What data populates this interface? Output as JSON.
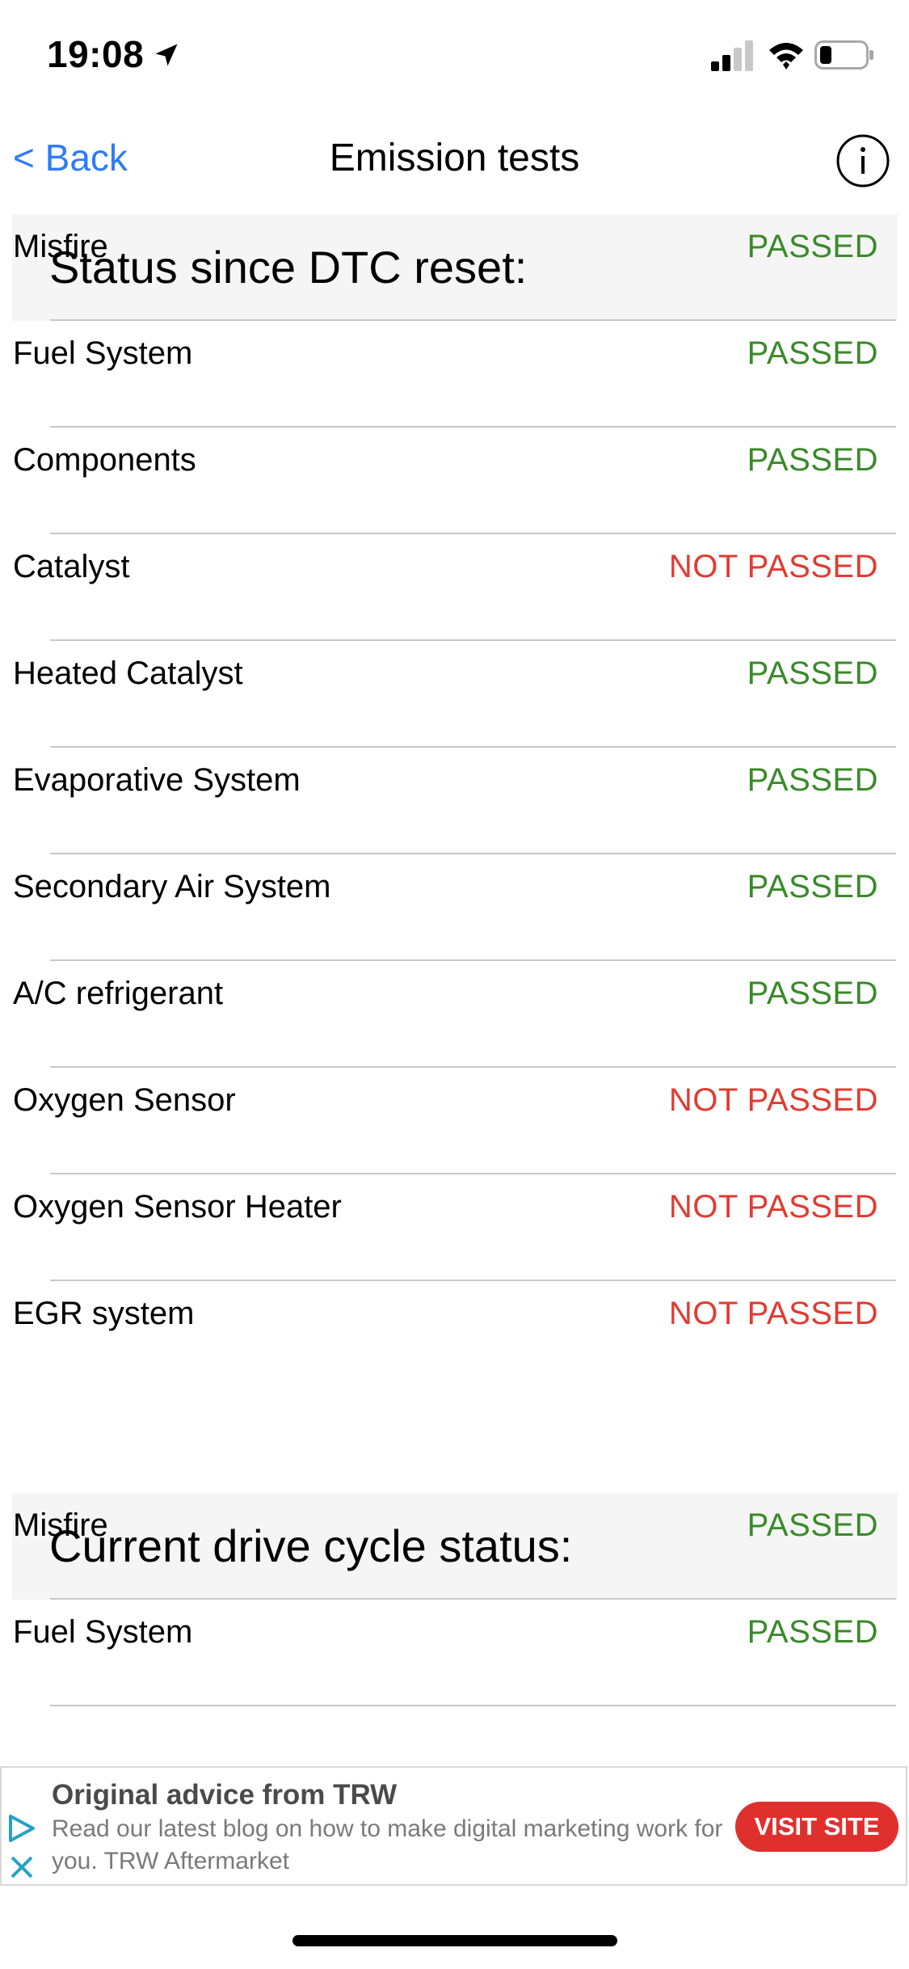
{
  "status_bar": {
    "time": "19:08"
  },
  "nav": {
    "back_label": "< Back",
    "title": "Emission tests"
  },
  "sections": [
    {
      "title": "Status since DTC reset:",
      "rows": [
        {
          "label": "Misfire",
          "status": "PASSED",
          "passed": true
        },
        {
          "label": "Fuel System",
          "status": "PASSED",
          "passed": true
        },
        {
          "label": "Components",
          "status": "PASSED",
          "passed": true
        },
        {
          "label": "Catalyst",
          "status": "NOT PASSED",
          "passed": false
        },
        {
          "label": "Heated Catalyst",
          "status": "PASSED",
          "passed": true
        },
        {
          "label": "Evaporative System",
          "status": "PASSED",
          "passed": true
        },
        {
          "label": "Secondary Air System",
          "status": "PASSED",
          "passed": true
        },
        {
          "label": "A/C refrigerant",
          "status": "PASSED",
          "passed": true
        },
        {
          "label": "Oxygen Sensor",
          "status": "NOT PASSED",
          "passed": false
        },
        {
          "label": "Oxygen Sensor Heater",
          "status": "NOT PASSED",
          "passed": false
        },
        {
          "label": "EGR system",
          "status": "NOT PASSED",
          "passed": false
        }
      ]
    },
    {
      "title": "Current drive cycle status:",
      "rows": [
        {
          "label": "Misfire",
          "status": "PASSED",
          "passed": true
        },
        {
          "label": "Fuel System",
          "status": "PASSED",
          "passed": true
        }
      ]
    }
  ],
  "ad": {
    "title": "Original advice from TRW",
    "body": "Read our latest blog on how to make digital marketing work for you. TRW Aftermarket",
    "button_label": "VISIT SITE"
  },
  "colors": {
    "passed": "#3a8a2a",
    "not_passed": "#e23b32",
    "link": "#2f7cf6",
    "ad_button": "#e0302e"
  }
}
